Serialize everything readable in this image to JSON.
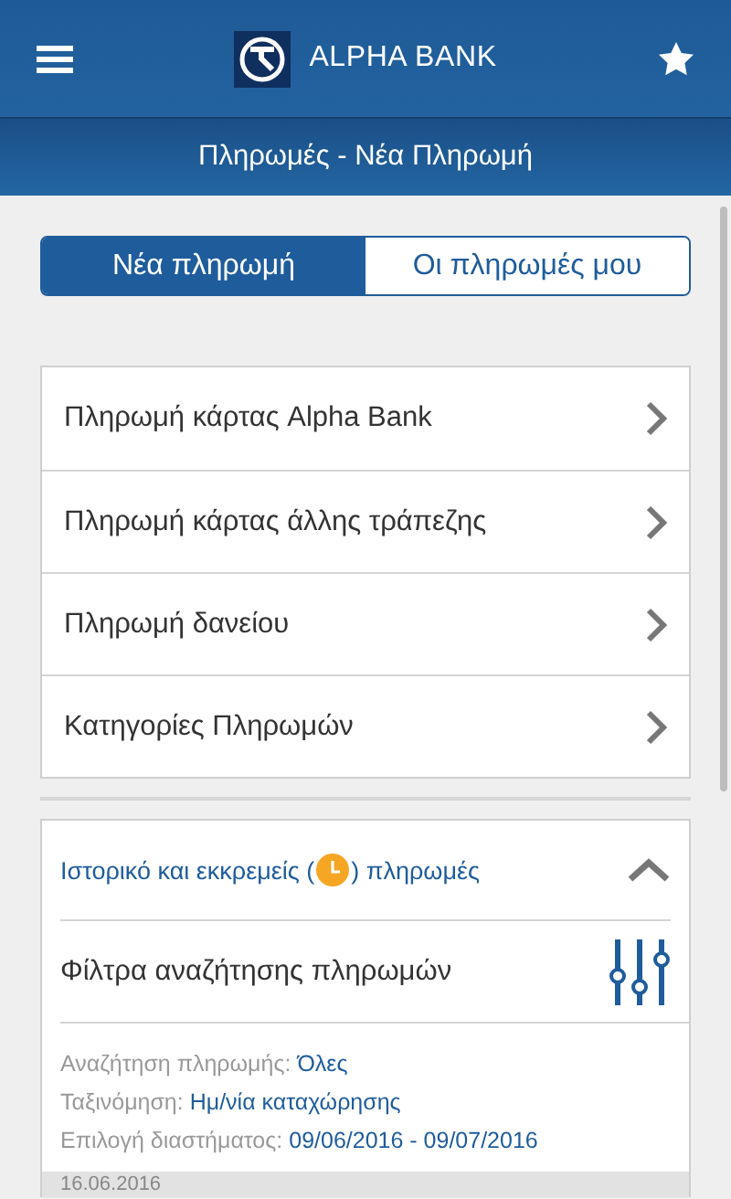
{
  "header": {
    "logo_text": "ALPHA BANK"
  },
  "page_title": "Πληρωμές - Νέα Πληρωμή",
  "tabs": [
    {
      "label": "Νέα πληρωμή",
      "selected": true
    },
    {
      "label": "Οι πληρωμές μου",
      "selected": false
    }
  ],
  "menu_items": [
    "Πληρωμή κάρτας Alpha Bank",
    "Πληρωμή κάρτας άλλης τράπεζης",
    "Πληρωμή δανείου",
    "Κατηγορίες Πληρωμών"
  ],
  "history": {
    "title_before": "Ιστορικό και εκκρεμείς (",
    "title_after": ") πληρωμές",
    "expanded": true,
    "filters_label": "Φίλτρα αναζήτησης πληρωμών",
    "filters": [
      {
        "label": "Αναζήτηση πληρωμής:",
        "value": "Όλες"
      },
      {
        "label": "Ταξινόμηση:",
        "value": "Ημ/νία καταχώρησης"
      },
      {
        "label": "Επιλογή διαστήματος:",
        "value": "09/06/2016 - 09/07/2016"
      }
    ],
    "first_date": "16.06.2016"
  }
}
